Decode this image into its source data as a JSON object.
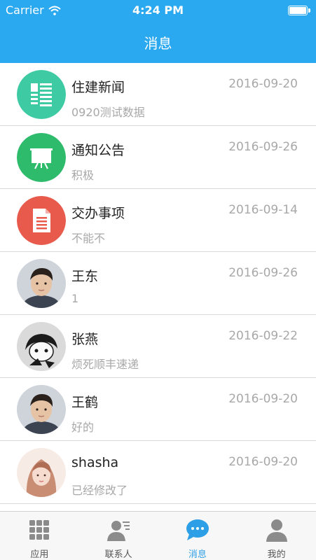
{
  "status_bar": {
    "carrier": "Carrier",
    "time": "4:24 PM"
  },
  "nav": {
    "title": "消息"
  },
  "messages": [
    {
      "name": "住建新闻",
      "date": "2016-09-20",
      "preview": "0920测试数据",
      "icon": "news-icon",
      "color": "#3ecba4"
    },
    {
      "name": "通知公告",
      "date": "2016-09-26",
      "preview": "积极",
      "icon": "presentation-board-icon",
      "color": "#2ebb6c"
    },
    {
      "name": "交办事项",
      "date": "2016-09-14",
      "preview": "不能不",
      "icon": "document-icon",
      "color": "#e85b4c"
    },
    {
      "name": "王东",
      "date": "2016-09-26",
      "preview": "1",
      "icon": "user-photo",
      "color": "#d9b79c"
    },
    {
      "name": "张燕",
      "date": "2016-09-22",
      "preview": "烦死顺丰速递",
      "icon": "user-cartoon",
      "color": "#d8d8d8"
    },
    {
      "name": "王鹤",
      "date": "2016-09-20",
      "preview": "好的",
      "icon": "user-photo",
      "color": "#d9b79c"
    },
    {
      "name": "shasha",
      "date": "2016-09-20",
      "preview": "已经修改了",
      "icon": "user-photo",
      "color": "#f2d7cf"
    }
  ],
  "tabs": [
    {
      "label": "应用",
      "icon": "grid-icon",
      "active": false
    },
    {
      "label": "联系人",
      "icon": "contacts-icon",
      "active": false
    },
    {
      "label": "消息",
      "icon": "chat-bubble-icon",
      "active": true
    },
    {
      "label": "我的",
      "icon": "person-icon",
      "active": false
    }
  ],
  "colors": {
    "accent": "#2aa8f0",
    "active_tab": "#2d9fe6",
    "inactive_tab": "#8b8b8b"
  }
}
